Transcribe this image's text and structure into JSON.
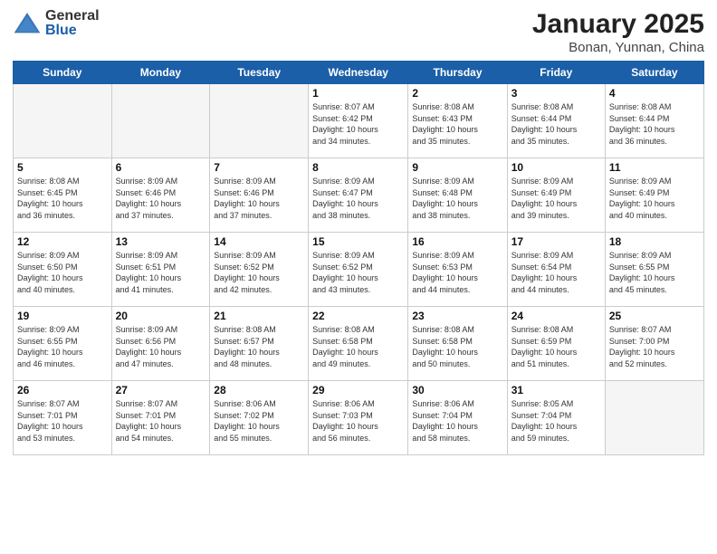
{
  "header": {
    "logo_general": "General",
    "logo_blue": "Blue",
    "month_title": "January 2025",
    "location": "Bonan, Yunnan, China"
  },
  "weekdays": [
    "Sunday",
    "Monday",
    "Tuesday",
    "Wednesday",
    "Thursday",
    "Friday",
    "Saturday"
  ],
  "weeks": [
    [
      {
        "num": "",
        "info": ""
      },
      {
        "num": "",
        "info": ""
      },
      {
        "num": "",
        "info": ""
      },
      {
        "num": "1",
        "info": "Sunrise: 8:07 AM\nSunset: 6:42 PM\nDaylight: 10 hours\nand 34 minutes."
      },
      {
        "num": "2",
        "info": "Sunrise: 8:08 AM\nSunset: 6:43 PM\nDaylight: 10 hours\nand 35 minutes."
      },
      {
        "num": "3",
        "info": "Sunrise: 8:08 AM\nSunset: 6:44 PM\nDaylight: 10 hours\nand 35 minutes."
      },
      {
        "num": "4",
        "info": "Sunrise: 8:08 AM\nSunset: 6:44 PM\nDaylight: 10 hours\nand 36 minutes."
      }
    ],
    [
      {
        "num": "5",
        "info": "Sunrise: 8:08 AM\nSunset: 6:45 PM\nDaylight: 10 hours\nand 36 minutes."
      },
      {
        "num": "6",
        "info": "Sunrise: 8:09 AM\nSunset: 6:46 PM\nDaylight: 10 hours\nand 37 minutes."
      },
      {
        "num": "7",
        "info": "Sunrise: 8:09 AM\nSunset: 6:46 PM\nDaylight: 10 hours\nand 37 minutes."
      },
      {
        "num": "8",
        "info": "Sunrise: 8:09 AM\nSunset: 6:47 PM\nDaylight: 10 hours\nand 38 minutes."
      },
      {
        "num": "9",
        "info": "Sunrise: 8:09 AM\nSunset: 6:48 PM\nDaylight: 10 hours\nand 38 minutes."
      },
      {
        "num": "10",
        "info": "Sunrise: 8:09 AM\nSunset: 6:49 PM\nDaylight: 10 hours\nand 39 minutes."
      },
      {
        "num": "11",
        "info": "Sunrise: 8:09 AM\nSunset: 6:49 PM\nDaylight: 10 hours\nand 40 minutes."
      }
    ],
    [
      {
        "num": "12",
        "info": "Sunrise: 8:09 AM\nSunset: 6:50 PM\nDaylight: 10 hours\nand 40 minutes."
      },
      {
        "num": "13",
        "info": "Sunrise: 8:09 AM\nSunset: 6:51 PM\nDaylight: 10 hours\nand 41 minutes."
      },
      {
        "num": "14",
        "info": "Sunrise: 8:09 AM\nSunset: 6:52 PM\nDaylight: 10 hours\nand 42 minutes."
      },
      {
        "num": "15",
        "info": "Sunrise: 8:09 AM\nSunset: 6:52 PM\nDaylight: 10 hours\nand 43 minutes."
      },
      {
        "num": "16",
        "info": "Sunrise: 8:09 AM\nSunset: 6:53 PM\nDaylight: 10 hours\nand 44 minutes."
      },
      {
        "num": "17",
        "info": "Sunrise: 8:09 AM\nSunset: 6:54 PM\nDaylight: 10 hours\nand 44 minutes."
      },
      {
        "num": "18",
        "info": "Sunrise: 8:09 AM\nSunset: 6:55 PM\nDaylight: 10 hours\nand 45 minutes."
      }
    ],
    [
      {
        "num": "19",
        "info": "Sunrise: 8:09 AM\nSunset: 6:55 PM\nDaylight: 10 hours\nand 46 minutes."
      },
      {
        "num": "20",
        "info": "Sunrise: 8:09 AM\nSunset: 6:56 PM\nDaylight: 10 hours\nand 47 minutes."
      },
      {
        "num": "21",
        "info": "Sunrise: 8:08 AM\nSunset: 6:57 PM\nDaylight: 10 hours\nand 48 minutes."
      },
      {
        "num": "22",
        "info": "Sunrise: 8:08 AM\nSunset: 6:58 PM\nDaylight: 10 hours\nand 49 minutes."
      },
      {
        "num": "23",
        "info": "Sunrise: 8:08 AM\nSunset: 6:58 PM\nDaylight: 10 hours\nand 50 minutes."
      },
      {
        "num": "24",
        "info": "Sunrise: 8:08 AM\nSunset: 6:59 PM\nDaylight: 10 hours\nand 51 minutes."
      },
      {
        "num": "25",
        "info": "Sunrise: 8:07 AM\nSunset: 7:00 PM\nDaylight: 10 hours\nand 52 minutes."
      }
    ],
    [
      {
        "num": "26",
        "info": "Sunrise: 8:07 AM\nSunset: 7:01 PM\nDaylight: 10 hours\nand 53 minutes."
      },
      {
        "num": "27",
        "info": "Sunrise: 8:07 AM\nSunset: 7:01 PM\nDaylight: 10 hours\nand 54 minutes."
      },
      {
        "num": "28",
        "info": "Sunrise: 8:06 AM\nSunset: 7:02 PM\nDaylight: 10 hours\nand 55 minutes."
      },
      {
        "num": "29",
        "info": "Sunrise: 8:06 AM\nSunset: 7:03 PM\nDaylight: 10 hours\nand 56 minutes."
      },
      {
        "num": "30",
        "info": "Sunrise: 8:06 AM\nSunset: 7:04 PM\nDaylight: 10 hours\nand 58 minutes."
      },
      {
        "num": "31",
        "info": "Sunrise: 8:05 AM\nSunset: 7:04 PM\nDaylight: 10 hours\nand 59 minutes."
      },
      {
        "num": "",
        "info": ""
      }
    ]
  ]
}
